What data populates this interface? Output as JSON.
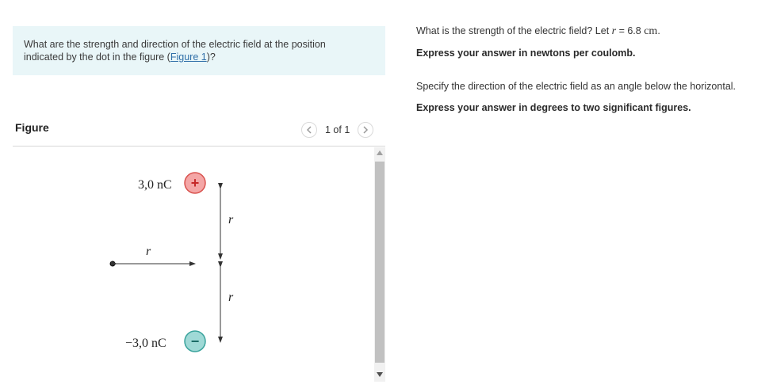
{
  "problem": {
    "text": "What are the strength and direction of the electric field at the position",
    "text_line2": "indicated by the dot in the figure (",
    "figure_link": "Figure 1",
    "text_end": ")?"
  },
  "figure_panel": {
    "title": "Figure",
    "pager": "1 of 1",
    "prev_icon": "chevron-left-icon",
    "next_icon": "chevron-right-icon"
  },
  "diagram": {
    "top_charge_label": "3,0 nC",
    "top_charge_sign": "+",
    "bottom_charge_label": "−3,0 nC",
    "bottom_charge_sign": "−",
    "r_horizontal": "r",
    "r_upper": "r",
    "r_lower": "r",
    "positive_color": "#f4a6a6",
    "negative_color": "#9fd9d6"
  },
  "parts": {
    "q1_prefix": "What is the strength of the electric field? Let ",
    "q1_var": "r",
    "q1_eq": " = 6.8 ",
    "q1_unit": "cm",
    "q1_period": ".",
    "q1_instruction": "Express your answer in newtons per coulomb.",
    "q2_text": "Specify the direction of the electric field as an angle below the horizontal.",
    "q2_instruction": "Express your answer in degrees to two significant figures."
  }
}
